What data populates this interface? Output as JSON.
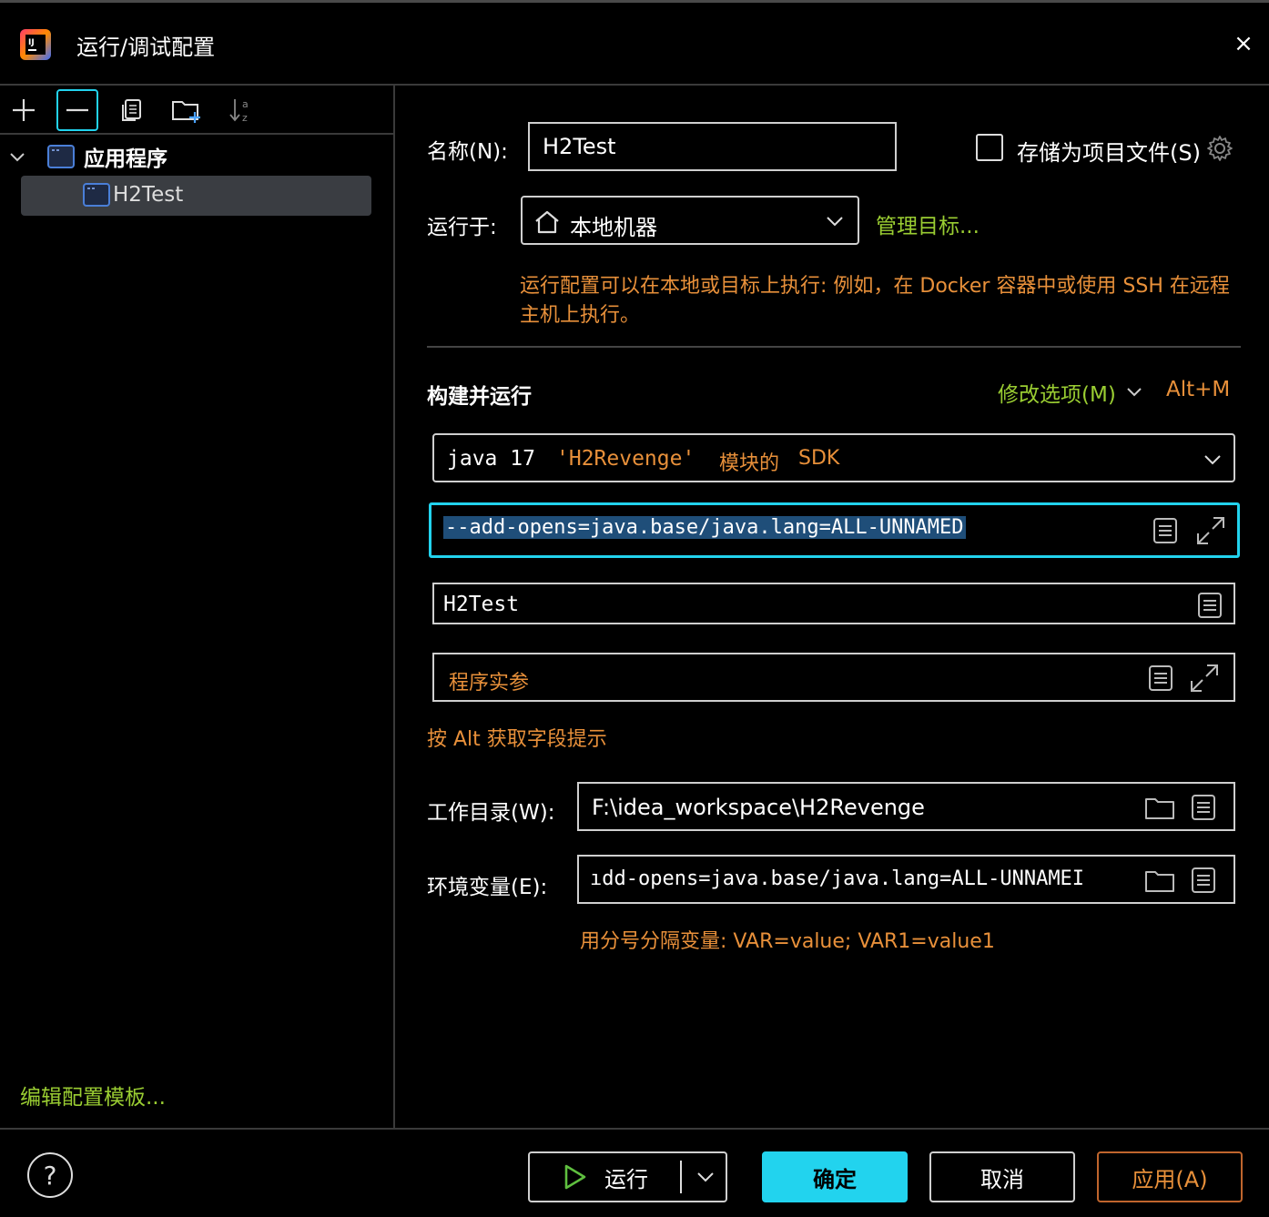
{
  "window": {
    "title": "运行/调试配置",
    "close_icon": "×"
  },
  "toolbar": {
    "icons": [
      "add-icon",
      "remove-icon",
      "copy-icon",
      "new-folder-icon",
      "sort-icon"
    ]
  },
  "tree": {
    "group_label": "应用程序",
    "items": [
      {
        "label": "H2Test"
      }
    ]
  },
  "left_footer": {
    "edit_templates_link": "编辑配置模板..."
  },
  "form": {
    "name_label": "名称(N):",
    "name_value": "H2Test",
    "store_checkbox_label": "存储为项目文件(S)",
    "run_on_label": "运行于:",
    "run_on_value": "本地机器",
    "manage_targets_link": "管理目标...",
    "run_on_hint_line1": "运行配置可以在本地或目标上执行: 例如，在 Docker 容器中或使用 SSH 在远程",
    "run_on_hint_line2": "主机上执行。",
    "section_title": "构建并运行",
    "modify_options_label": "修改选项(M)",
    "modify_options_shortcut": "Alt+M",
    "sdk_java": "java 17",
    "sdk_module": "'H2Revenge'",
    "sdk_suffix": "模块的",
    "sdk_sdk": "SDK",
    "vm_options_value": "--add-opens=java.base/java.lang=ALL-UNNAMED",
    "main_class_value": "H2Test",
    "program_args_placeholder": "程序实参",
    "alt_hint": "按 Alt 获取字段提示",
    "workdir_label": "工作目录(W):",
    "workdir_value": "F:\\idea_workspace\\H2Revenge",
    "env_label": "环境变量(E):",
    "env_value": "ıdd-opens=java.base/java.lang=ALL-UNNAMEI",
    "env_hint": "用分号分隔变量: VAR=value; VAR1=value1"
  },
  "footer": {
    "help_label": "?",
    "run_label": "运行",
    "ok_label": "确定",
    "cancel_label": "取消",
    "apply_label": "应用(A)"
  },
  "colors": {
    "accent_cyan": "#22d3ee",
    "link_green": "#9acd32",
    "hint_orange": "#e8903a",
    "selection_blue": "#1f4e79",
    "apply_border": "#c0652d"
  }
}
